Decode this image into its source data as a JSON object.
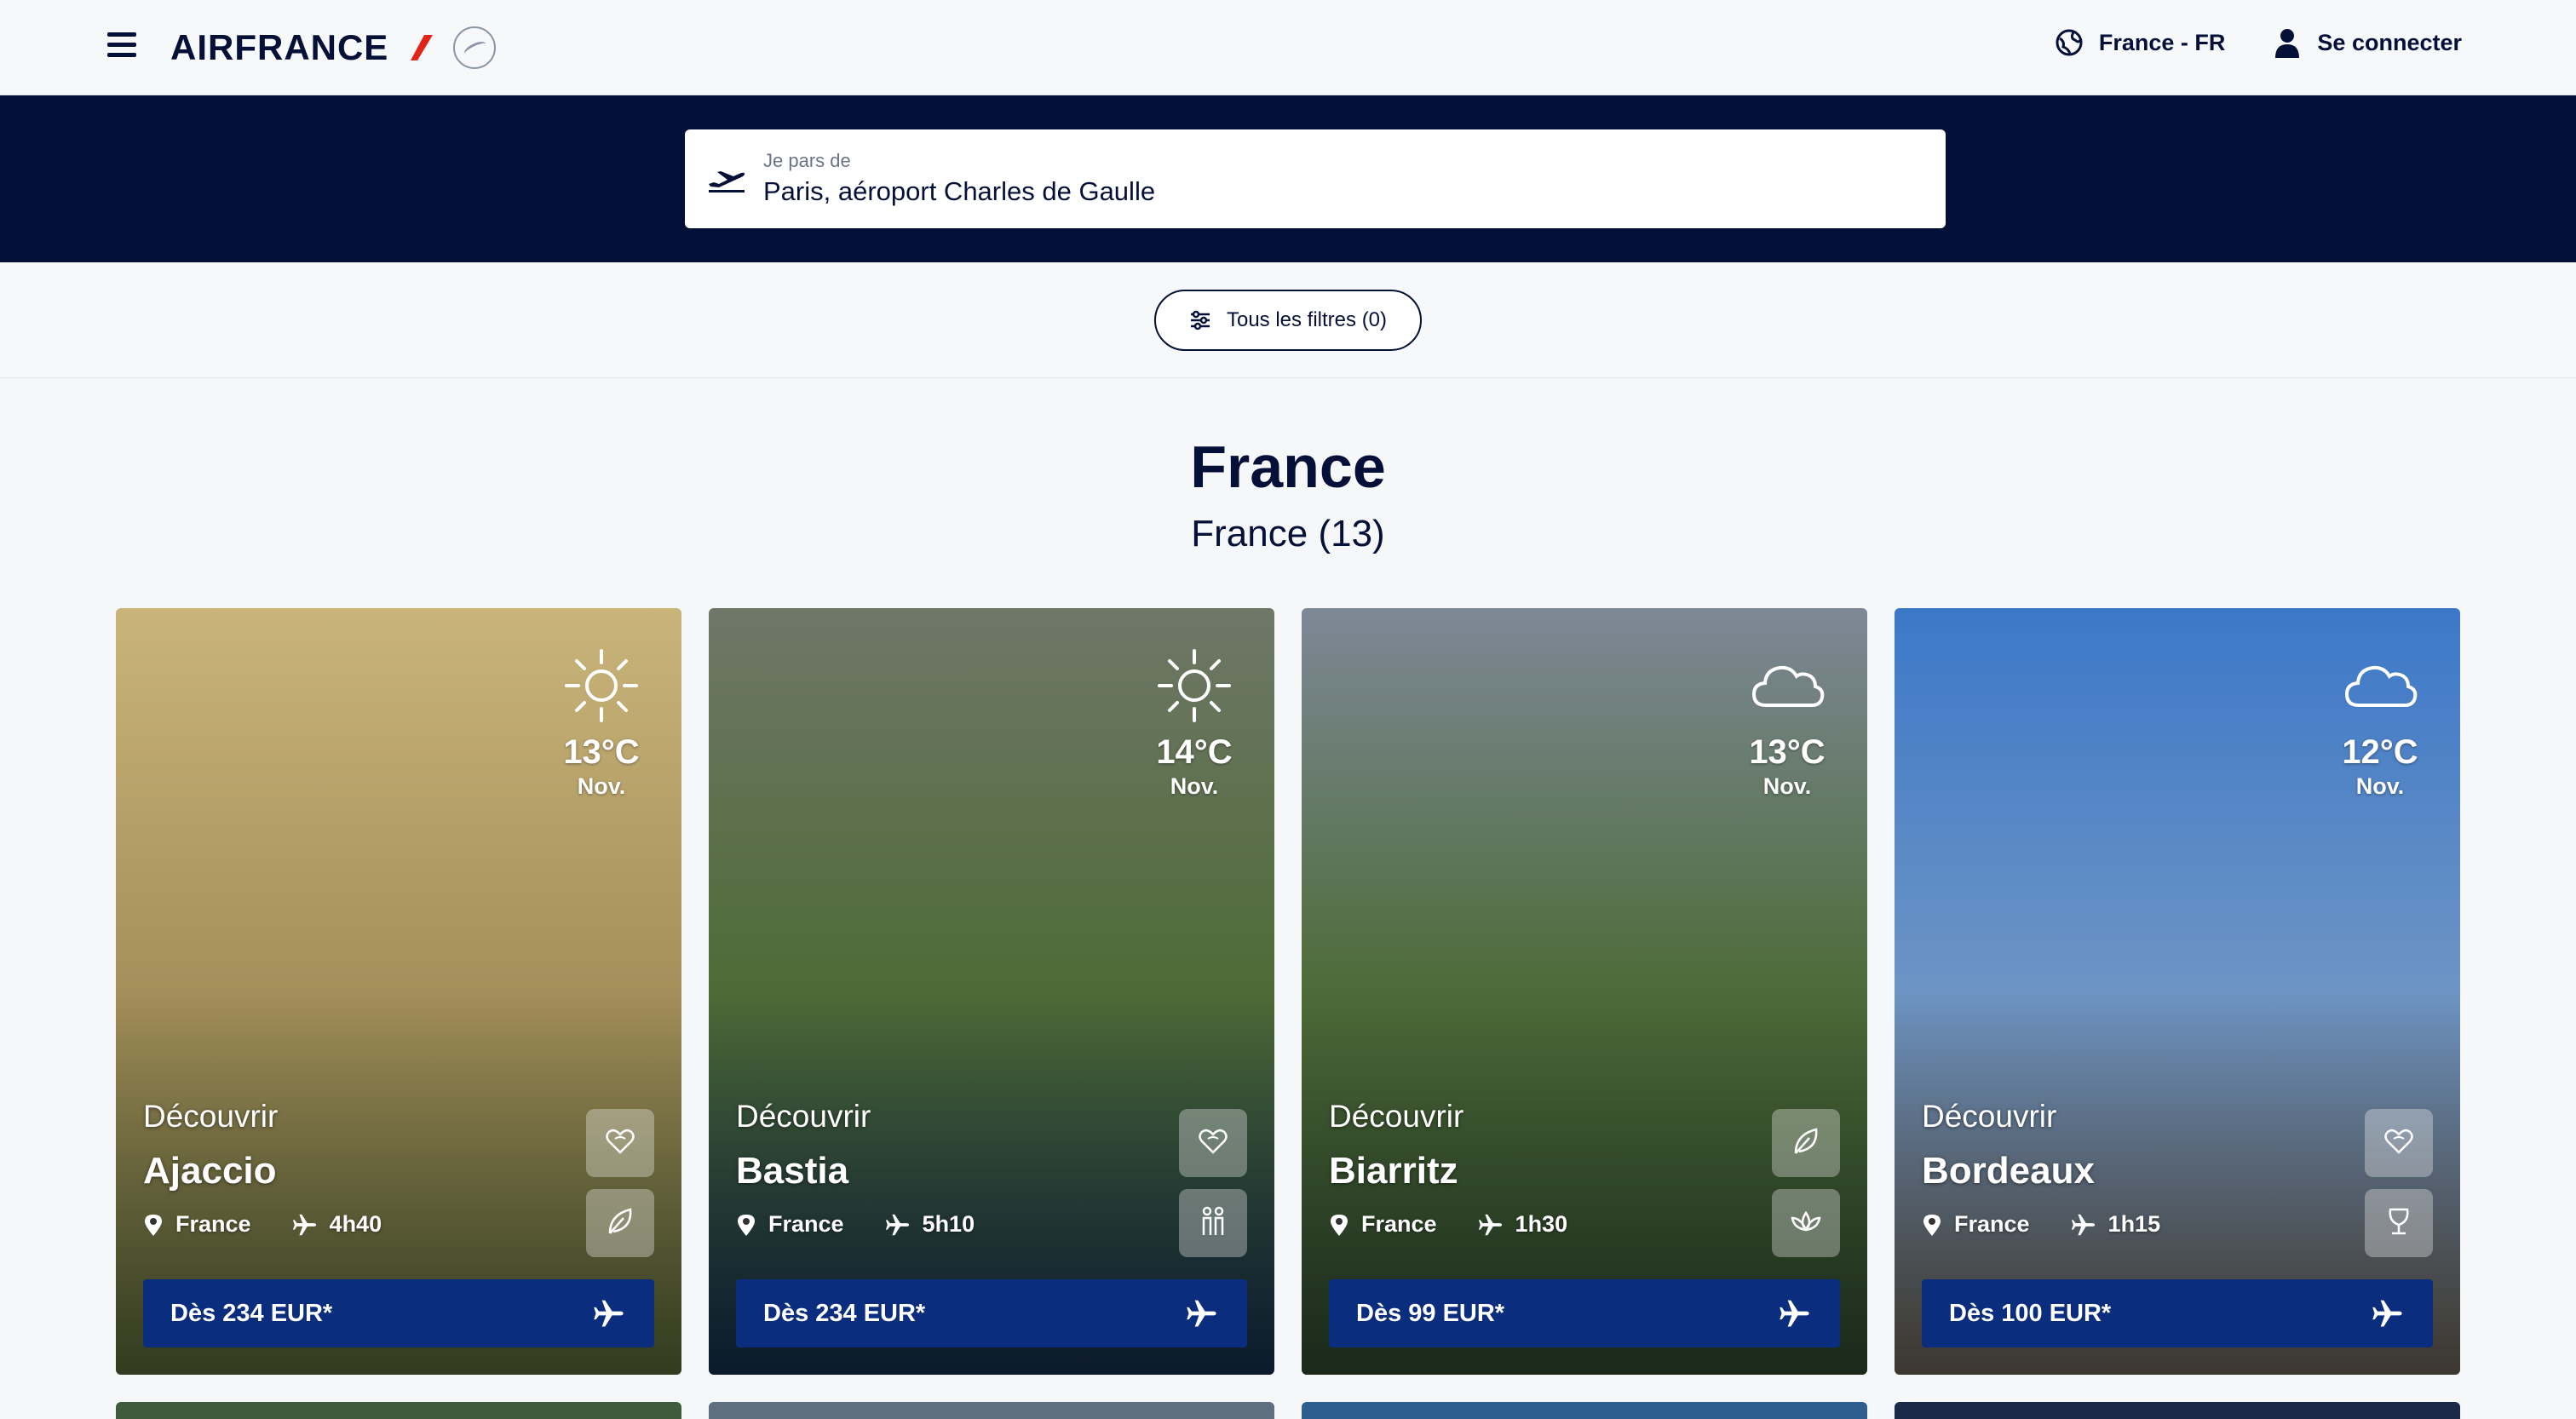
{
  "header": {
    "brand": "AIRFRANCE",
    "locale": "France - FR",
    "login": "Se connecter"
  },
  "search": {
    "label": "Je pars de",
    "value": "Paris, aéroport Charles de Gaulle"
  },
  "filters": {
    "label": "Tous les filtres (0)"
  },
  "section": {
    "title": "France",
    "subtitle": "France (13)"
  },
  "cards": [
    {
      "discover": "Découvrir",
      "city": "Ajaccio",
      "country": "France",
      "duration": "4h40",
      "temp": "13°C",
      "month": "Nov.",
      "weather_icon": "sun-icon",
      "tags": [
        "heart-icon",
        "leaf-icon"
      ],
      "price": "Dès 234 EUR*",
      "bg_colors": [
        "#c9b47a",
        "#a58f5a",
        "#5c6b3a"
      ]
    },
    {
      "discover": "Découvrir",
      "city": "Bastia",
      "country": "France",
      "duration": "5h10",
      "temp": "14°C",
      "month": "Nov.",
      "weather_icon": "sun-icon",
      "tags": [
        "heart-icon",
        "couple-icon"
      ],
      "price": "Dès 234 EUR*",
      "bg_colors": [
        "#6f7768",
        "#4e6b36",
        "#15304f"
      ]
    },
    {
      "discover": "Découvrir",
      "city": "Biarritz",
      "country": "France",
      "duration": "1h30",
      "temp": "13°C",
      "month": "Nov.",
      "weather_icon": "cloud-icon",
      "tags": [
        "leaf-icon",
        "lotus-icon"
      ],
      "price": "Dès 99 EUR*",
      "bg_colors": [
        "#7d8896",
        "#4d6b38",
        "#2f4a30"
      ]
    },
    {
      "discover": "Découvrir",
      "city": "Bordeaux",
      "country": "France",
      "duration": "1h15",
      "temp": "12°C",
      "month": "Nov.",
      "weather_icon": "cloud-icon",
      "tags": [
        "heart-icon",
        "wine-icon"
      ],
      "price": "Dès 100 EUR*",
      "bg_colors": [
        "#3c78c8",
        "#6d94c4",
        "#6d6558"
      ]
    }
  ]
}
